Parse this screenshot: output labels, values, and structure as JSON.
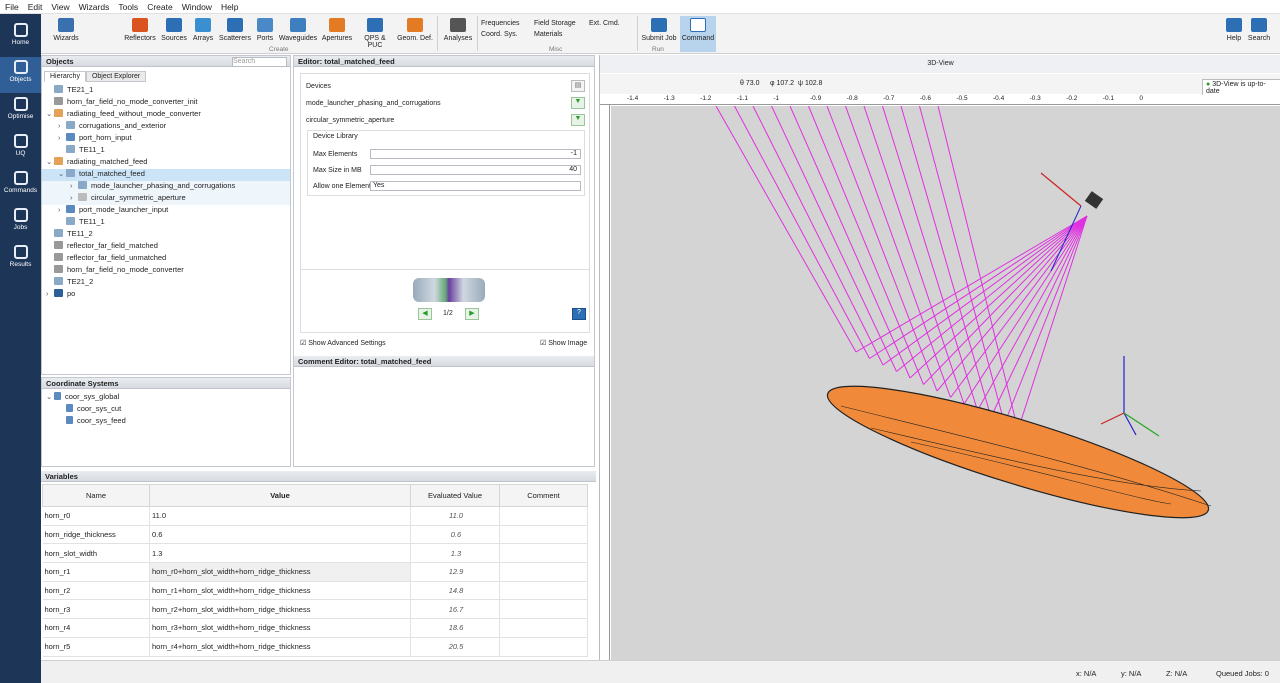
{
  "menu": [
    "File",
    "Edit",
    "View",
    "Wizards",
    "Tools",
    "Create",
    "Window",
    "Help"
  ],
  "ribbon": {
    "wizards": "Wizards",
    "reflectors": "Reflectors",
    "sources": "Sources",
    "arrays": "Arrays",
    "scatterers": "Scatterers",
    "ports": "Ports",
    "waveguides": "Waveguides",
    "apertures": "Apertures",
    "qps": "QPS & PUC",
    "geomdef": "Geom. Def.",
    "create_group": "Create",
    "analyses": "Analyses",
    "frequencies": "Frequencies",
    "field_storage": "Field Storage",
    "ext_cmd": "Ext. Cmd.",
    "coord_sys": "Coord. Sys.",
    "materials": "Materials",
    "misc_group": "Misc",
    "submit_job": "Submit Job",
    "command": "Command",
    "run_group": "Run",
    "help": "Help",
    "search": "Search"
  },
  "sidebar": [
    "Home",
    "Objects",
    "Optimise",
    "UQ",
    "Commands",
    "Jobs",
    "Results"
  ],
  "objects": {
    "title": "Objects",
    "search_placeholder": "Search",
    "tab_hierarchy": "Hierarchy",
    "tab_explorer": "Object Explorer",
    "tree": [
      "TE21_1",
      "horn_far_field_no_mode_converter_init",
      "radiating_feed_without_mode_converter",
      "corrugations_and_exterior",
      "port_horn_input",
      "TE11_1",
      "radiating_matched_feed",
      "total_matched_feed",
      "mode_launcher_phasing_and_corrugations",
      "circular_symmetric_aperture",
      "port_mode_launcher_input",
      "TE11_1",
      "TE11_2",
      "reflector_far_field_matched",
      "reflector_far_field_unmatched",
      "horn_far_field_no_mode_converter",
      "TE21_2",
      "po"
    ]
  },
  "coord": {
    "title": "Coordinate Systems",
    "items": [
      "coor_sys_global",
      "coor_sys_cut",
      "coor_sys_feed"
    ]
  },
  "editor": {
    "title": "Editor: total_matched_feed",
    "devices": "Devices",
    "dev1": "mode_launcher_phasing_and_corrugations",
    "dev2": "circular_symmetric_aperture",
    "library": "Device Library",
    "max_elements_label": "Max Elements",
    "max_elements": "-1",
    "max_size_label": "Max Size in MB",
    "max_size": "40",
    "allow_label": "Allow one Element",
    "allow": "Yes",
    "page": "1/2",
    "show_adv": "Show Advanced Settings",
    "show_img": "Show Image"
  },
  "comment": {
    "title": "Comment Editor: total_matched_feed"
  },
  "variables": {
    "title": "Variables",
    "headers": [
      "Name",
      "Value",
      "Evaluated Value",
      "Comment"
    ],
    "rows": [
      [
        "horn_r0",
        "11.0",
        "11.0"
      ],
      [
        "horn_ridge_thickness",
        "0.6",
        "0.6"
      ],
      [
        "horn_slot_width",
        "1.3",
        "1.3"
      ],
      [
        "horn_r1",
        "horn_r0+horn_slot_width+horn_ridge_thickness",
        "12.9"
      ],
      [
        "horn_r2",
        "horn_r1+horn_slot_width+horn_ridge_thickness",
        "14.8"
      ],
      [
        "horn_r3",
        "horn_r2+horn_slot_width+horn_ridge_thickness",
        "16.7"
      ],
      [
        "horn_r4",
        "horn_r3+horn_slot_width+horn_ridge_thickness",
        "18.6"
      ],
      [
        "horn_r5",
        "horn_r4+horn_slot_width+horn_ridge_thickness",
        "20.5"
      ]
    ]
  },
  "view3d": {
    "title": "3D-View",
    "theta": "73.0",
    "phi": "107.2",
    "psi": "102.8",
    "status": "3D-View is up-to-date",
    "ruler": [
      "-1.4",
      "-1.3",
      "-1.2",
      "-1.1",
      "-1",
      "-0.9",
      "-0.8",
      "-0.7",
      "-0.6",
      "-0.5",
      "-0.4",
      "-0.3",
      "-0.2",
      "-0.1",
      "0"
    ]
  },
  "status": {
    "x": "x: N/A",
    "y": "y: N/A",
    "z": "Z: N/A",
    "queued": "Queued Jobs: 0"
  }
}
